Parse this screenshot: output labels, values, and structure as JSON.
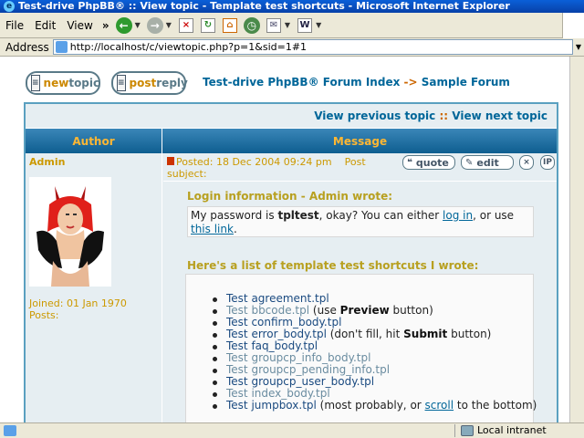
{
  "window": {
    "title": "Test-drive PhpBB® :: View topic - Template test shortcuts - Microsoft Internet Explorer"
  },
  "menu": {
    "items": [
      {
        "label": "File"
      },
      {
        "label": "Edit"
      },
      {
        "label": "View"
      }
    ],
    "more": "»"
  },
  "address": {
    "label": "Address",
    "url": "http://localhost/c/viewtopic.php?p=1&sid=1#1"
  },
  "actions": {
    "new_topic_a": "new",
    "new_topic_b": "topic",
    "post_reply_a": "post",
    "post_reply_b": "reply"
  },
  "breadcrumb": {
    "index": "Test-drive PhpBB® Forum Index",
    "separator": "->",
    "forum": "Sample Forum"
  },
  "topic_nav": {
    "previous": "View previous topic",
    "separator": "::",
    "next": "View next topic"
  },
  "table_headers": {
    "author": "Author",
    "message": "Message"
  },
  "post": {
    "author": "Admin",
    "joined": "Joined: 01 Jan 1970",
    "posts": "Posts:",
    "posted": "Posted: 18 Dec 2004 09:24 pm",
    "subject_label": "Post subject:",
    "buttons": {
      "quote": "quote",
      "edit": "edit",
      "delete": "×",
      "ip": "IP"
    },
    "quote_title": "Login information - Admin wrote:",
    "quote_text_1": "My password is ",
    "quote_password": "tpltest",
    "quote_text_2": ", okay? You can either ",
    "quote_link_1": "log in",
    "quote_text_3": ", or use ",
    "quote_link_2": "this link",
    "quote_text_4": ".",
    "list_title": "Here's a list of template test shortcuts I wrote:",
    "shortcuts": [
      {
        "text": "Test agreement.tpl",
        "style": "dark",
        "note": ""
      },
      {
        "text": "Test bbcode.tpl",
        "style": "grey",
        "note_before": " (use ",
        "note_bold": "Preview",
        "note_after": " button)"
      },
      {
        "text": "Test confirm_body.tpl",
        "style": "dark",
        "note": ""
      },
      {
        "text": "Test error_body.tpl",
        "style": "dark",
        "note_before": " (don't fill, hit ",
        "note_bold": "Submit",
        "note_after": " button)"
      },
      {
        "text": "Test faq_body.tpl",
        "style": "dark",
        "note": ""
      },
      {
        "text": "Test groupcp_info_body.tpl",
        "style": "grey",
        "note": ""
      },
      {
        "text": "Test groupcp_pending_info.tpl",
        "style": "grey",
        "note": ""
      },
      {
        "text": "Test groupcp_user_body.tpl",
        "style": "dark",
        "note": ""
      },
      {
        "text": "Test index_body.tpl",
        "style": "grey",
        "note": ""
      },
      {
        "text": "Test jumpbox.tpl",
        "style": "dark",
        "note_before": " (most probably, or ",
        "note_link": "scroll",
        "note_after": " to the bottom)"
      }
    ]
  },
  "status": {
    "zone": "Local intranet"
  },
  "colors": {
    "accent": "#006699",
    "header_gradient_top": "#3a86b8",
    "header_text": "#ffb733",
    "author_text": "#cc9900"
  }
}
